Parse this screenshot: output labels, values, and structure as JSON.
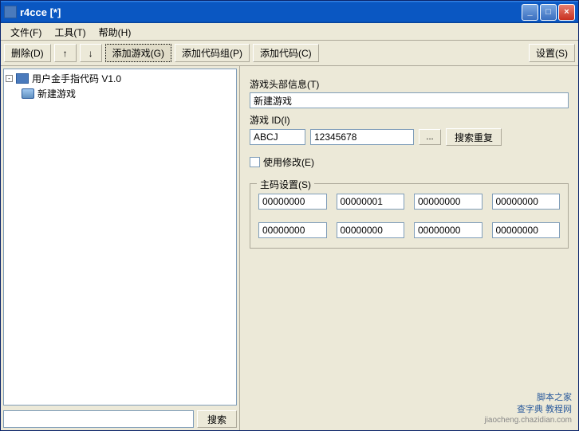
{
  "title": "r4cce [*]",
  "menu": {
    "file": "文件(F)",
    "tools": "工具(T)",
    "help": "帮助(H)"
  },
  "toolbar": {
    "delete": "删除(D)",
    "add_game": "添加游戏(G)",
    "add_code_group": "添加代码组(P)",
    "add_code": "添加代码(C)",
    "settings": "设置(S)"
  },
  "tree": {
    "root": "用户金手指代码 V1.0",
    "child": "新建游戏"
  },
  "search": {
    "placeholder": "",
    "button": "搜索"
  },
  "right": {
    "header_label": "游戏头部信息(T)",
    "header_value": "新建游戏",
    "gameid_label": "游戏 ID(I)",
    "gameid_part1": "ABCJ",
    "gameid_part2": "12345678",
    "browse": "...",
    "search_dup": "搜索重复",
    "use_modify": "使用修改(E)",
    "master_legend": "主码设置(S)",
    "codes": [
      "00000000",
      "00000001",
      "00000000",
      "00000000",
      "00000000",
      "00000000",
      "00000000",
      "00000000"
    ]
  },
  "watermark": {
    "line1": "脚本之家",
    "line2": "查字典 教程网",
    "url": "jiaocheng.chazidian.com"
  }
}
